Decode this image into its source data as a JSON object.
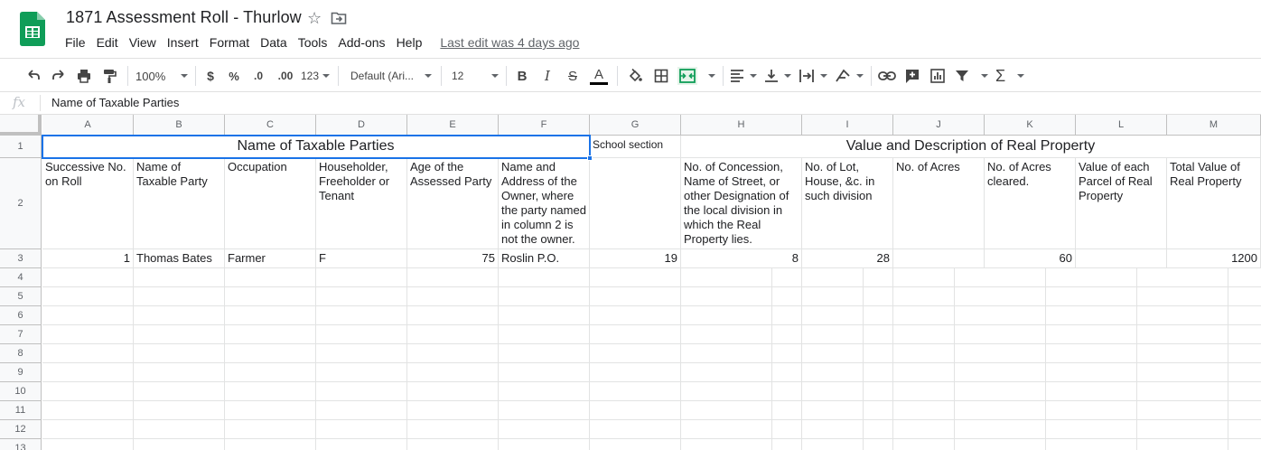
{
  "app": {
    "title": "1871 Assessment Roll - Thurlow",
    "last_edit": "Last edit was 4 days ago",
    "menu": [
      "File",
      "Edit",
      "View",
      "Insert",
      "Format",
      "Data",
      "Tools",
      "Add-ons",
      "Help"
    ]
  },
  "toolbar": {
    "zoom": "100%",
    "currency": "$",
    "percent": "%",
    "decrease_decimal": ".0",
    "increase_decimal": ".00",
    "more_formats": "123",
    "font": "Default (Ari...",
    "font_size": "12",
    "bold": "B",
    "italic": "I",
    "strikethrough": "S",
    "text_color": "A",
    "text_color_value": "#000000"
  },
  "formula_bar": {
    "fx": "fx",
    "content": "Name of Taxable Parties"
  },
  "columns": [
    "A",
    "B",
    "C",
    "D",
    "E",
    "F",
    "G",
    "H",
    "I",
    "J",
    "K",
    "L",
    "M"
  ],
  "rows": [
    "1",
    "2",
    "3",
    "4",
    "5",
    "6",
    "7",
    "8",
    "9",
    "10",
    "11",
    "12",
    "13"
  ],
  "sheet": {
    "row1": {
      "group1": "Name of Taxable Parties",
      "g1": "School section",
      "group2": "Value and Description of Real Property"
    },
    "row2": {
      "a": "Successive No. on Roll",
      "b": "Name of Taxable Party",
      "c": "Occupation",
      "d": "Householder, Freeholder or Tenant",
      "e": "Age of the Assessed Party",
      "f": "Name and Address of the Owner, where the party named in column 2 is not the owner.",
      "g": "",
      "h": "No. of Concession, Name of Street, or other Designation of the local division in which the Real Property lies.",
      "i": "No. of Lot, House, &c. in such division",
      "j": "No. of Acres",
      "k": "No. of Acres cleared.",
      "l": "Value of each Parcel of Real Property",
      "m": "Total Value of Real Property"
    },
    "row3": {
      "a": "1",
      "b": "Thomas Bates",
      "c": "Farmer",
      "d": "F",
      "e": "75",
      "f": "Roslin P.O.",
      "g": "19",
      "h": "8",
      "i": "28",
      "j": "",
      "k": "60",
      "l": "",
      "m": "1200"
    }
  },
  "colors": {
    "accent": "#1a73e8",
    "sheets_green": "#0f9d58",
    "header_bg": "#f8f9fa"
  }
}
